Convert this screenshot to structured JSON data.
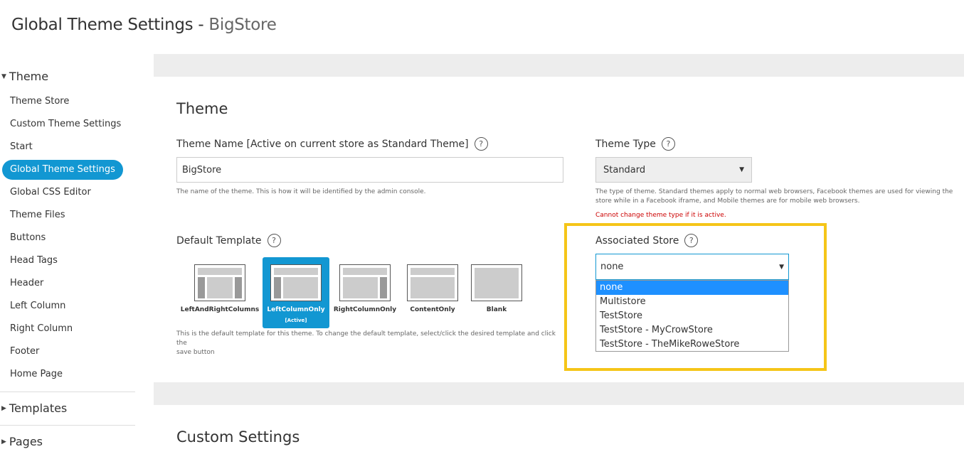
{
  "header": {
    "title_prefix": "Global Theme Settings - ",
    "title_store": "BigStore"
  },
  "sidebar": {
    "groups": [
      {
        "label": "Theme",
        "expanded": true
      },
      {
        "label": "Templates",
        "expanded": false
      },
      {
        "label": "Pages",
        "expanded": false
      }
    ],
    "items": [
      "Theme Store",
      "Custom Theme Settings",
      "Start",
      "Global Theme Settings",
      "Global CSS Editor",
      "Theme Files",
      "Buttons",
      "Head Tags",
      "Header",
      "Left Column",
      "Right Column",
      "Footer",
      "Home Page"
    ],
    "active_index": 3
  },
  "theme_card": {
    "title": "Theme",
    "theme_name": {
      "label": "Theme Name [Active on current store as Standard Theme]",
      "value": "BigStore",
      "hint": "The name of the theme. This is how it will be identified by the admin console."
    },
    "theme_type": {
      "label": "Theme Type",
      "value": "Standard",
      "hint_line1": "The type of theme. Standard themes apply to normal web browsers, Facebook themes are used for viewing the",
      "hint_line2": "store while in a Facebook iframe, and Mobile themes are for mobile web browsers.",
      "warning": "Cannot change theme type if it is active."
    },
    "default_template": {
      "label": "Default Template",
      "templates": [
        "LeftAndRightColumns",
        "LeftColumnOnly",
        "RightColumnOnly",
        "ContentOnly",
        "Blank"
      ],
      "active_index": 1,
      "active_tag": "[Active]",
      "hint_line1": "This is the default template for this theme. To change the default template, select/click the desired template and click the",
      "hint_line2": "save button"
    },
    "associated_store": {
      "label": "Associated Store",
      "value": "none",
      "options": [
        "none",
        "Multistore",
        "TestStore",
        "TestStore - MyCrowStore",
        "TestStore - TheMikeRoweStore"
      ],
      "selected_index": 0
    }
  },
  "custom_card": {
    "title": "Custom Settings"
  },
  "icons": {
    "help": "?",
    "arrow_down": "▼",
    "arrow_right": "▶"
  },
  "colors": {
    "accent": "#1297d2",
    "highlight": "#f5c518",
    "warning": "#cc0000"
  }
}
